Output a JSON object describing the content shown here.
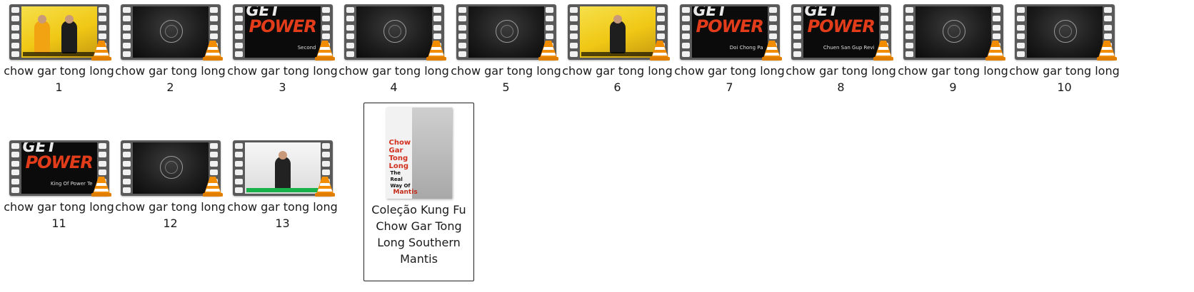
{
  "items": [
    {
      "label": "chow gar tong long 1",
      "thumb": "yellow-two-people"
    },
    {
      "label": "chow gar tong long 2",
      "thumb": "dark-emblem"
    },
    {
      "label": "chow gar tong long 3",
      "thumb": "get-power",
      "overlay": "Second"
    },
    {
      "label": "chow gar tong long 4",
      "thumb": "dark-emblem"
    },
    {
      "label": "chow gar tong long 5",
      "thumb": "dark-emblem"
    },
    {
      "label": "chow gar tong long 6",
      "thumb": "yellow-one-person"
    },
    {
      "label": "chow gar tong long 7",
      "thumb": "get-power",
      "overlay": "Doi Chong Pa"
    },
    {
      "label": "chow gar tong long 8",
      "thumb": "get-power",
      "overlay": "Chuen San Gup Revi"
    },
    {
      "label": "chow gar tong long 9",
      "thumb": "dark-emblem"
    },
    {
      "label": "chow gar tong long 10",
      "thumb": "dark-emblem"
    },
    {
      "label": "chow gar tong long 11",
      "thumb": "get-power",
      "overlay": "King Of Power Te"
    },
    {
      "label": "chow gar tong long 12",
      "thumb": "dark-emblem"
    },
    {
      "label": "chow gar tong long 13",
      "thumb": "white-one-person"
    }
  ],
  "folder": {
    "label": "Coleção Kung Fu Chow Gar Tong Long Southern Mantis",
    "cover_title": "Chow Gar Tong Long",
    "cover_subtitle": "The Real Way Of",
    "cover_word": "Mantis",
    "selected": true
  },
  "icons": {
    "media_badge": "vlc-cone-icon",
    "film_frame": "filmstrip-icon"
  },
  "colors": {
    "accent_orange": "#f28c00",
    "power_red": "#e23c1a",
    "filmstrip": "#5a5a5a"
  }
}
